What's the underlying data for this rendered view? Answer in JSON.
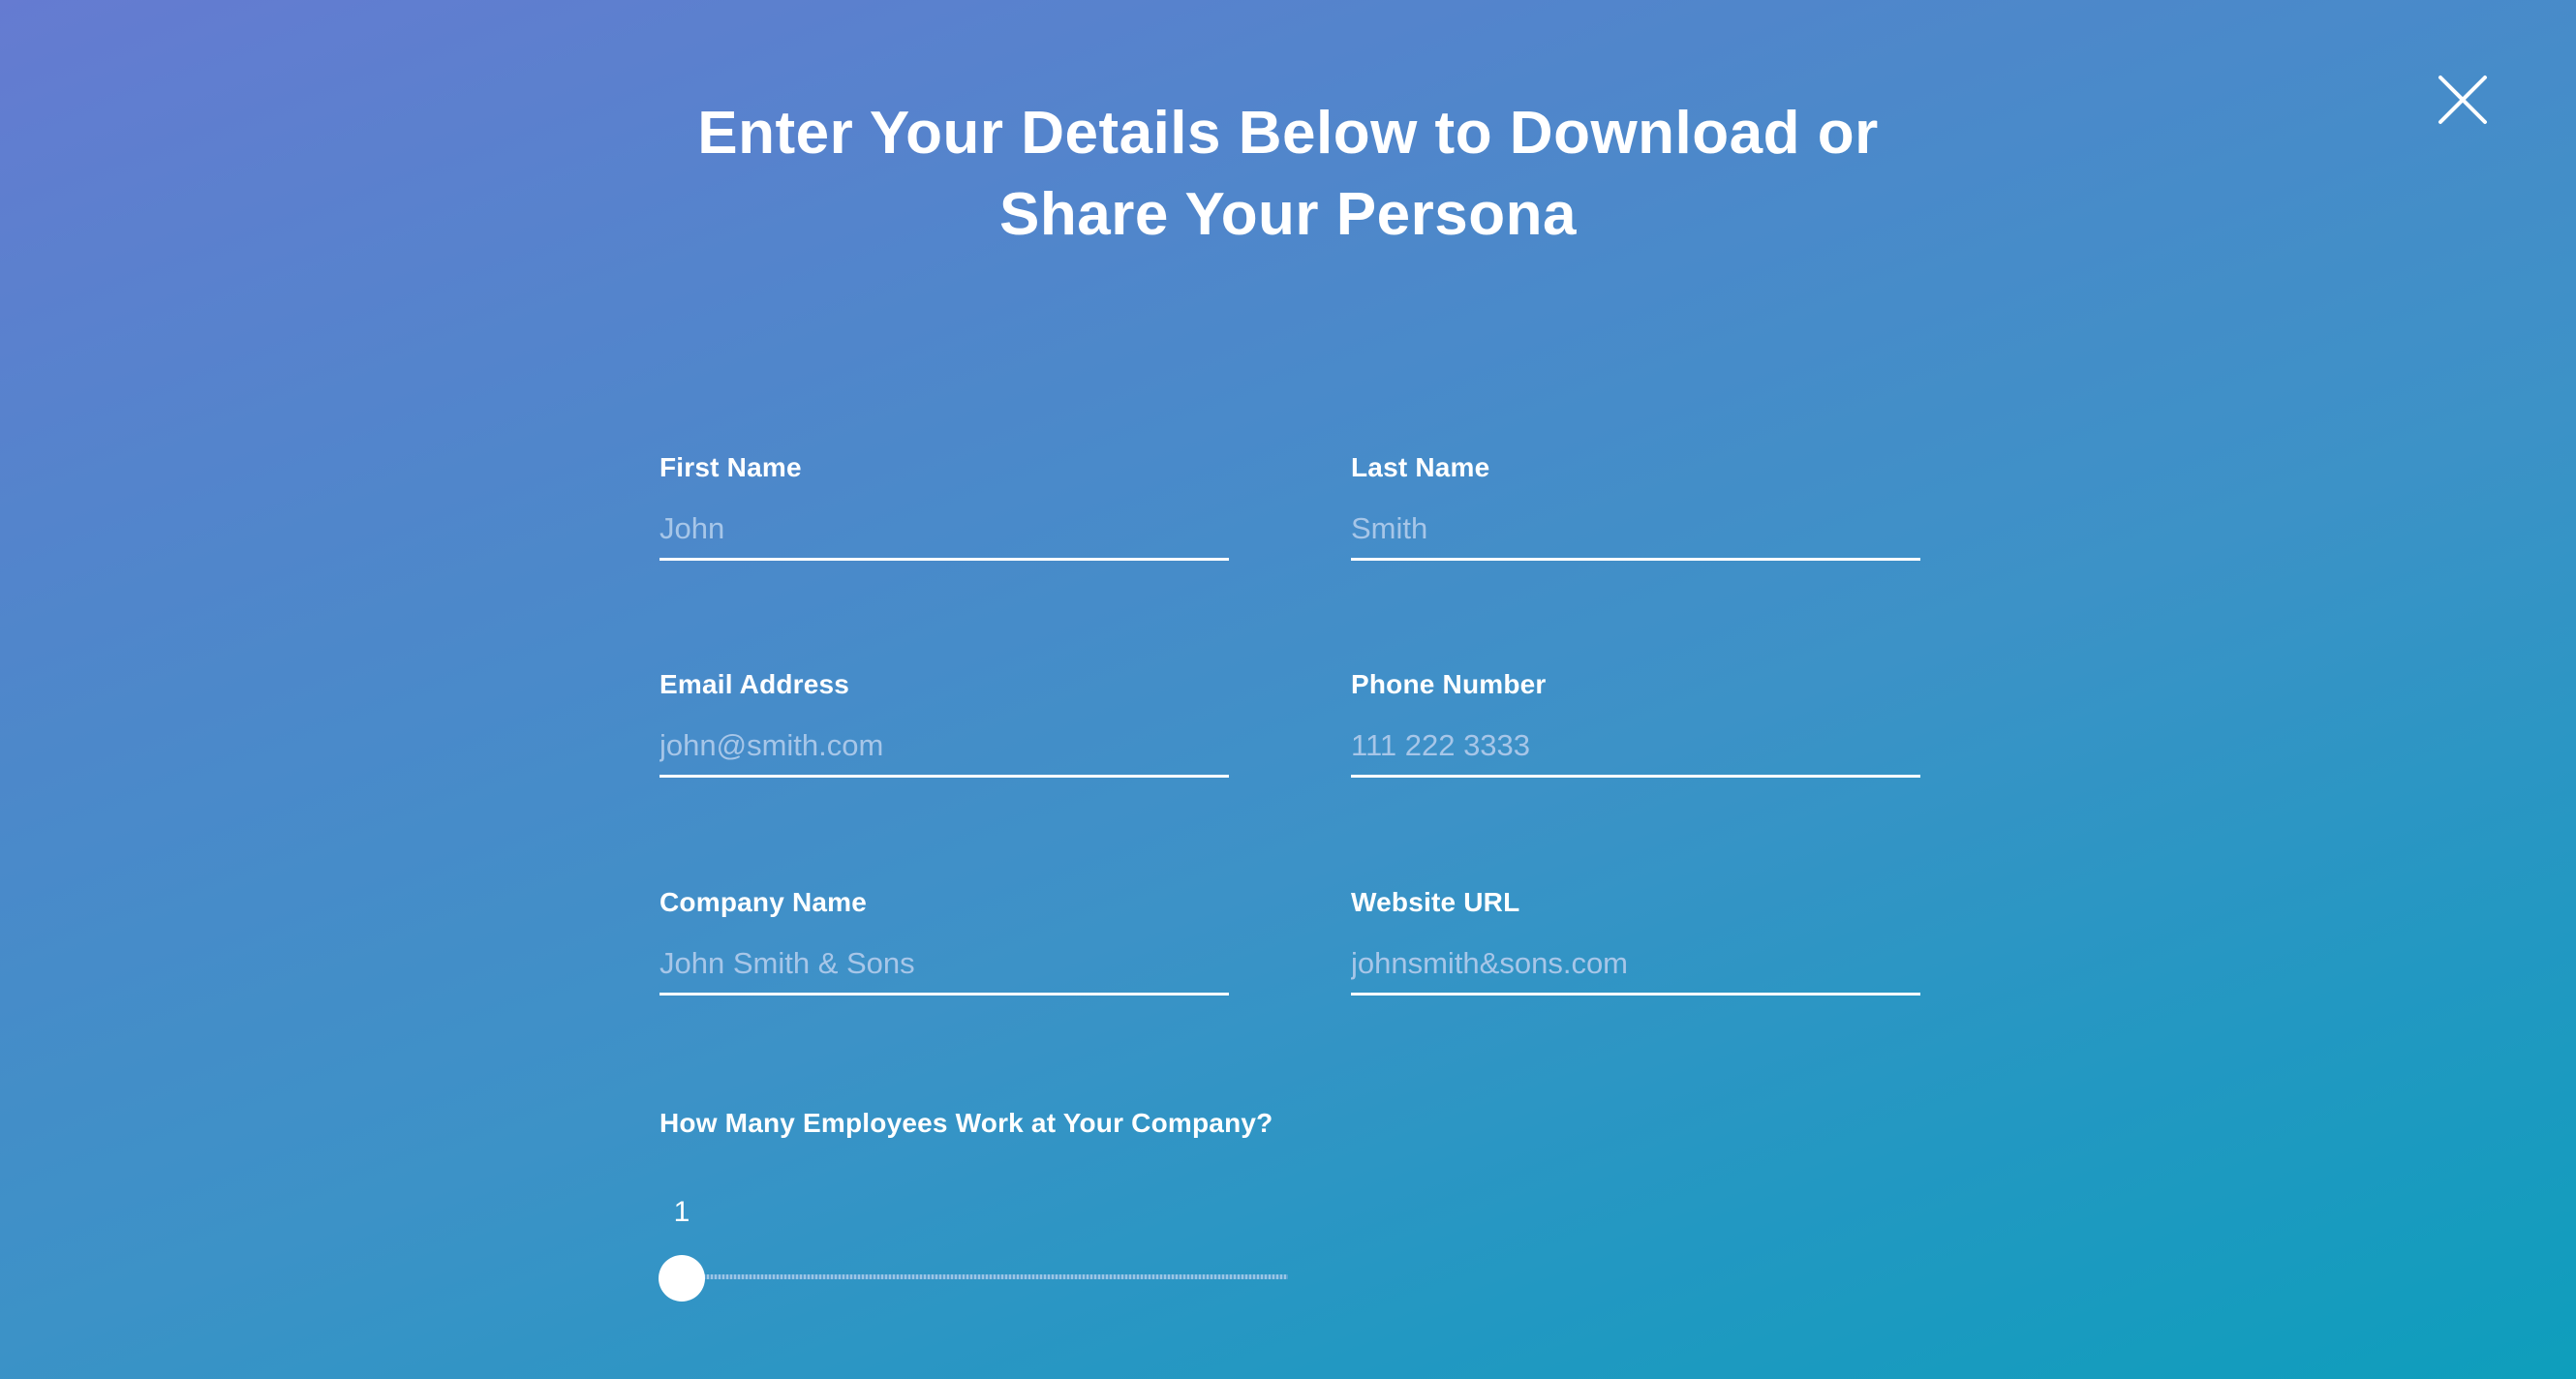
{
  "dialog": {
    "title_line_1": "Enter Your Details Below to Download or",
    "title_line_2": "Share Your Persona",
    "close_icon": "close-x-icon"
  },
  "form": {
    "fields": [
      {
        "label": "First Name",
        "placeholder": "John",
        "value": ""
      },
      {
        "label": "Last Name",
        "placeholder": "Smith",
        "value": ""
      },
      {
        "label": "Email Address",
        "placeholder": "john@smith.com",
        "value": ""
      },
      {
        "label": "Phone Number",
        "placeholder": "111 222 3333",
        "value": ""
      },
      {
        "label": "Company Name",
        "placeholder": "John Smith & Sons",
        "value": ""
      },
      {
        "label": "Website URL",
        "placeholder": "johnsmith&sons.com",
        "value": ""
      }
    ],
    "employees": {
      "question": "How Many Employees Work at Your Company?",
      "value": "1",
      "fill_fraction": 0
    }
  },
  "colors": {
    "gradient_start": "#647dd0",
    "gradient_end": "#109dbd",
    "text": "#ffffff",
    "placeholder": "#a7c6e8"
  }
}
